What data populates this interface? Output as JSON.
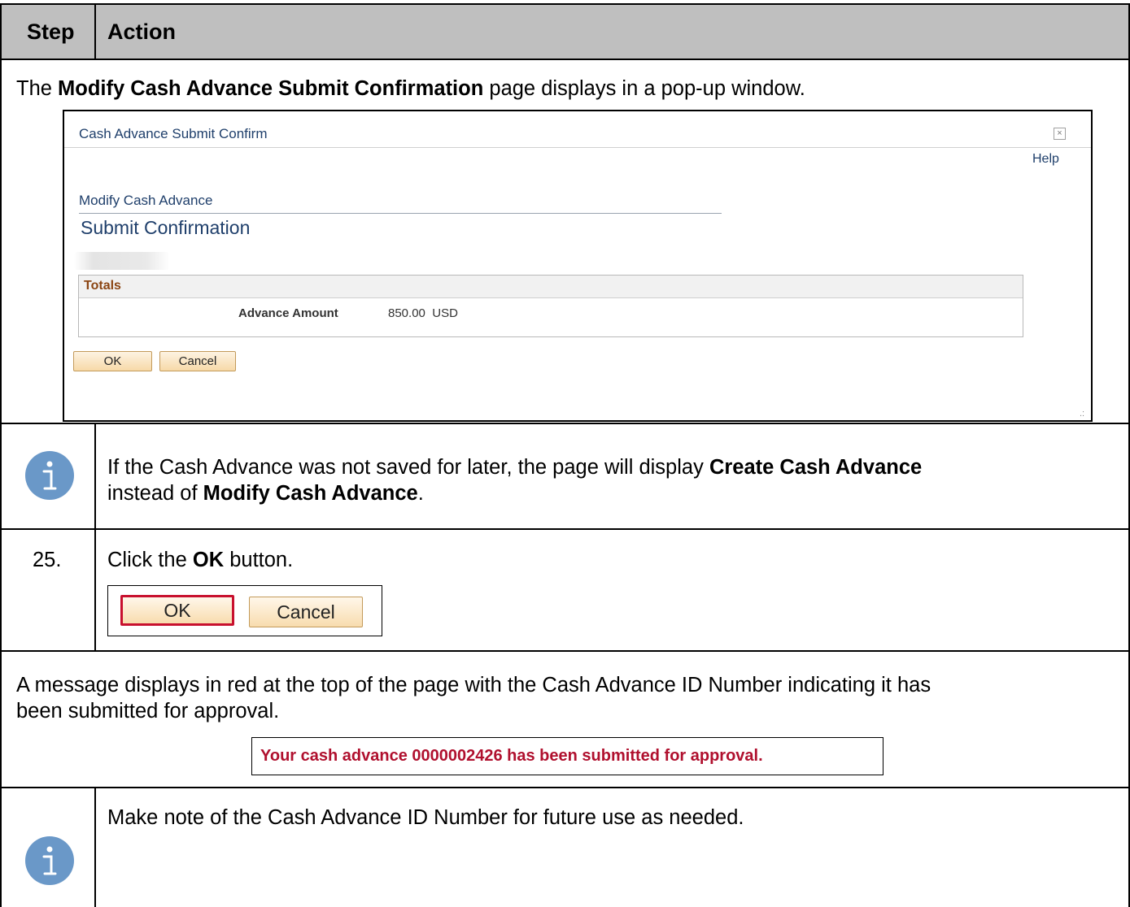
{
  "header": {
    "step_label": "Step",
    "action_label": "Action"
  },
  "intro": {
    "text_before": "The ",
    "bold": "Modify Cash Advance Submit Confirmation",
    "text_after": " page displays in a pop-up window."
  },
  "popup": {
    "title": "Cash Advance Submit Confirm",
    "close_glyph": "×",
    "help": "Help",
    "subtitle": "Modify Cash Advance",
    "heading": "Submit Confirmation",
    "totals_label": "Totals",
    "amount_label": "Advance Amount",
    "amount_value": "850.00",
    "currency": "USD",
    "ok_label": "OK",
    "cancel_label": "Cancel",
    "resize_glyph": ".:"
  },
  "note1": {
    "line1_before": "If the Cash Advance was not saved for later, the page will display ",
    "line1_bold": "Create Cash Advance",
    "line2_before": "instead of ",
    "line2_bold": "Modify Cash Advance",
    "line2_after": "."
  },
  "step25": {
    "number": "25.",
    "text_before": "Click the ",
    "bold": "OK",
    "text_after": " button.",
    "ok_label": "OK",
    "cancel_label": "Cancel"
  },
  "message_row": {
    "line1": "A message displays in red at the top of the page with the Cash Advance ID Number indicating it has",
    "line2": "been submitted for approval.",
    "message": "Your cash advance 0000002426 has been submitted for approval."
  },
  "note2": {
    "text": "Make note of the Cash Advance ID Number for future use as needed."
  },
  "colors": {
    "header_bg": "#bfbfbf",
    "info_icon": "#6a98c8",
    "highlight": "#c8102e",
    "message_red": "#b0102e",
    "link_blue": "#1f3f6b",
    "totals_label": "#8b4513"
  },
  "icons": [
    "info-icon",
    "close-icon",
    "resize-handle-icon"
  ]
}
